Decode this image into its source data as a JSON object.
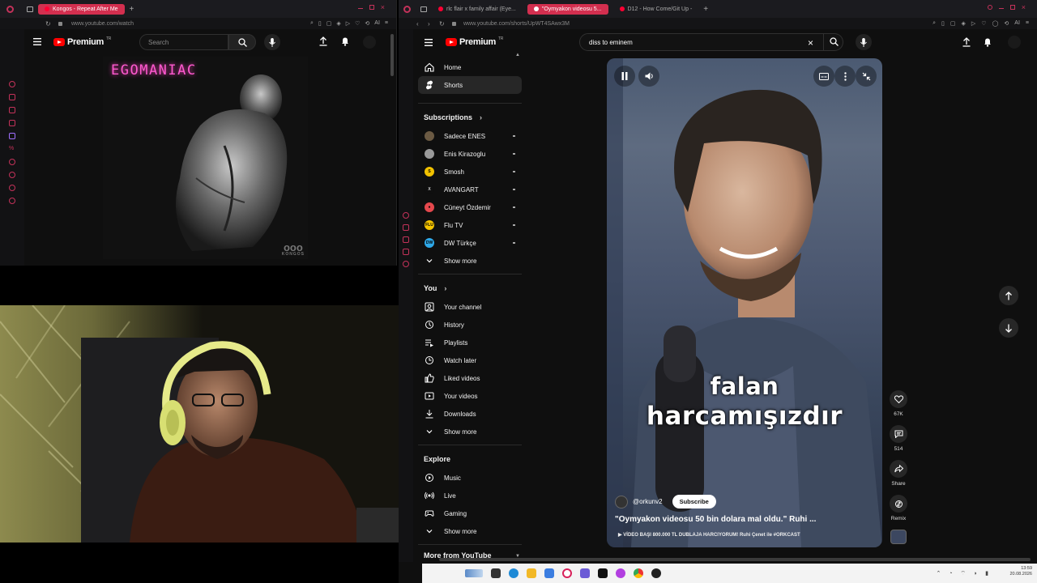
{
  "left_browser": {
    "tab_active": "Kongos - Repeat After Me",
    "url": "www.youtube.com/watch",
    "logo_text": "Premium",
    "logo_badge": "TR",
    "search_placeholder": "Search",
    "album": {
      "title": "EGOMANIAC",
      "brand_logo": "ooo",
      "brand_name": "KONGOS"
    }
  },
  "right_browser": {
    "tabs": [
      {
        "label": "rlc flair x family affair (Eye..."
      },
      {
        "label": "\"Oymyakon videosu 5..."
      },
      {
        "label": "D12 - How Come/Git Up -"
      }
    ],
    "url": "www.youtube.com/shorts/UpWT4SAwx3M",
    "logo_text": "Premium",
    "logo_badge": "TR",
    "search_value": "diss to eminem",
    "sidebar": {
      "main": [
        {
          "label": "Home",
          "icon": "home-icon"
        },
        {
          "label": "Shorts",
          "icon": "shorts-icon"
        }
      ],
      "subscriptions_header": "Subscriptions",
      "subscriptions": [
        {
          "label": "Sadece ENES",
          "color": "#6b5a43",
          "mark": ""
        },
        {
          "label": "Enis Kirazoglu",
          "color": "#9a9a9a",
          "mark": ""
        },
        {
          "label": "Smosh",
          "color": "#f2c200",
          "mark": "S"
        },
        {
          "label": "AVANGART",
          "color": "#0f0f0f",
          "mark": "X"
        },
        {
          "label": "Cüneyt Özdemir",
          "color": "#e5484d",
          "mark": "●"
        },
        {
          "label": "Flu TV",
          "color": "#f5c400",
          "mark": "FLU"
        },
        {
          "label": "DW Türkçe",
          "color": "#2ea8e8",
          "mark": "DW"
        }
      ],
      "show_more": "Show more",
      "you_header": "You",
      "you_items": [
        {
          "label": "Your channel",
          "icon": "channel-icon"
        },
        {
          "label": "History",
          "icon": "history-icon"
        },
        {
          "label": "Playlists",
          "icon": "playlists-icon"
        },
        {
          "label": "Watch later",
          "icon": "watch-later-icon"
        },
        {
          "label": "Liked videos",
          "icon": "like-icon"
        },
        {
          "label": "Your videos",
          "icon": "your-videos-icon"
        },
        {
          "label": "Downloads",
          "icon": "download-icon"
        }
      ],
      "explore_header": "Explore",
      "explore_items": [
        {
          "label": "Music",
          "icon": "music-icon"
        },
        {
          "label": "Live",
          "icon": "live-icon"
        },
        {
          "label": "Gaming",
          "icon": "gaming-icon"
        }
      ],
      "more_header": "More from YouTube"
    },
    "short": {
      "caption_line1": "falan",
      "caption_line2": "harcamışızdır",
      "channel": "@orkunv2",
      "subscribe_label": "Subscribe",
      "title": "\"Oymyakon videosu 50 bin dolara mal oldu.\" Ruhi ...",
      "subtitle": "VİDEO BAŞI 800.000 TL DUBLAJA HARCIYORUM! Ruhi Çenet ile #ORKCAST",
      "likes": "67K",
      "comments": "514",
      "share_label": "Share",
      "remix_label": "Remix"
    },
    "taskbar": {
      "time": "13:59",
      "date": "20.08.2026"
    }
  }
}
